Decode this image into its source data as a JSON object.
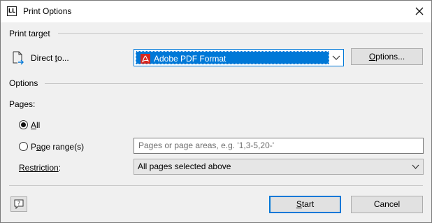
{
  "window": {
    "title": "Print Options",
    "app_icon_text": "LL"
  },
  "print_target": {
    "group_label": "Print target",
    "direct_to_label": "Direct to...",
    "direct_to_prefix": "Direct ",
    "direct_to_accel": "t",
    "direct_to_suffix": "o...",
    "selected_value": "Adobe PDF Format",
    "options_button_accel": "O",
    "options_button_rest": "ptions..."
  },
  "options": {
    "group_label": "Options",
    "pages_label": "Pages:",
    "all_accel": "A",
    "all_rest": "ll",
    "all_checked": true,
    "range_prefix": "P",
    "range_accel": "a",
    "range_rest": "ge range(s)",
    "range_checked": false,
    "range_placeholder": "Pages or page areas, e.g. '1,3-5,20-'",
    "restriction_prefix": "Restriction",
    "restriction_suffix": ":",
    "restriction_value": "All pages selected above"
  },
  "footer": {
    "start_accel": "S",
    "start_rest": "tart",
    "cancel_label": "Cancel"
  },
  "colors": {
    "accent": "#0078d7",
    "pdf_icon": "#d7261e"
  }
}
